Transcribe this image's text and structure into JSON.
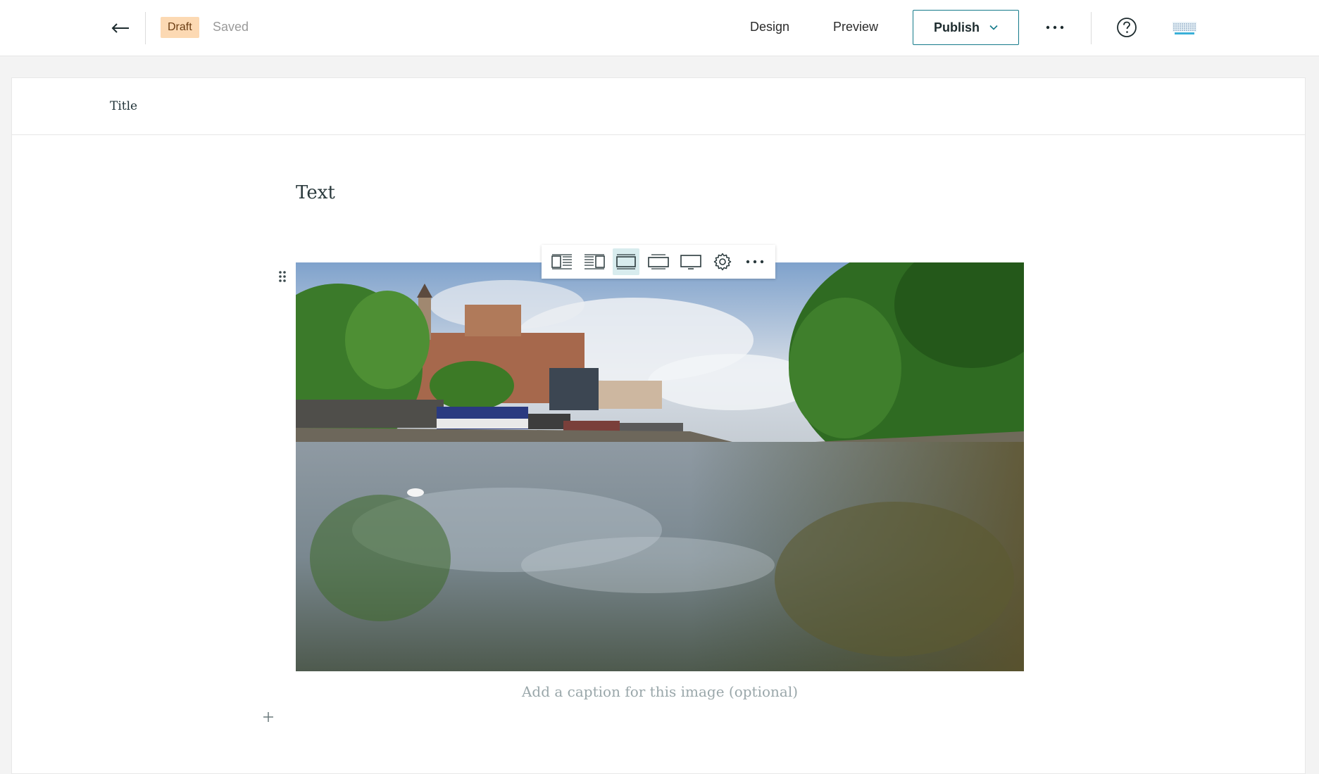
{
  "header": {
    "status_badge": "Draft",
    "save_status": "Saved",
    "nav": {
      "design": "Design",
      "preview": "Preview"
    },
    "publish_label": "Publish"
  },
  "editor": {
    "title_placeholder": "Title",
    "text_block": "Text",
    "image": {
      "caption_placeholder": "Add a caption for this image (optional)",
      "toolbar": [
        {
          "name": "float-left-layout-icon",
          "active": false
        },
        {
          "name": "float-right-layout-icon",
          "active": false
        },
        {
          "name": "standard-layout-icon",
          "active": true
        },
        {
          "name": "wide-layout-icon",
          "active": false
        },
        {
          "name": "full-width-layout-icon",
          "active": false
        },
        {
          "name": "settings-gear-icon",
          "active": false
        },
        {
          "name": "more-options-icon",
          "active": false
        }
      ]
    }
  },
  "colors": {
    "accent": "#147a8a",
    "draft_badge_bg": "#fcd9b3",
    "draft_badge_text": "#6b3d12",
    "toolbar_active_bg": "#d8ecee"
  }
}
